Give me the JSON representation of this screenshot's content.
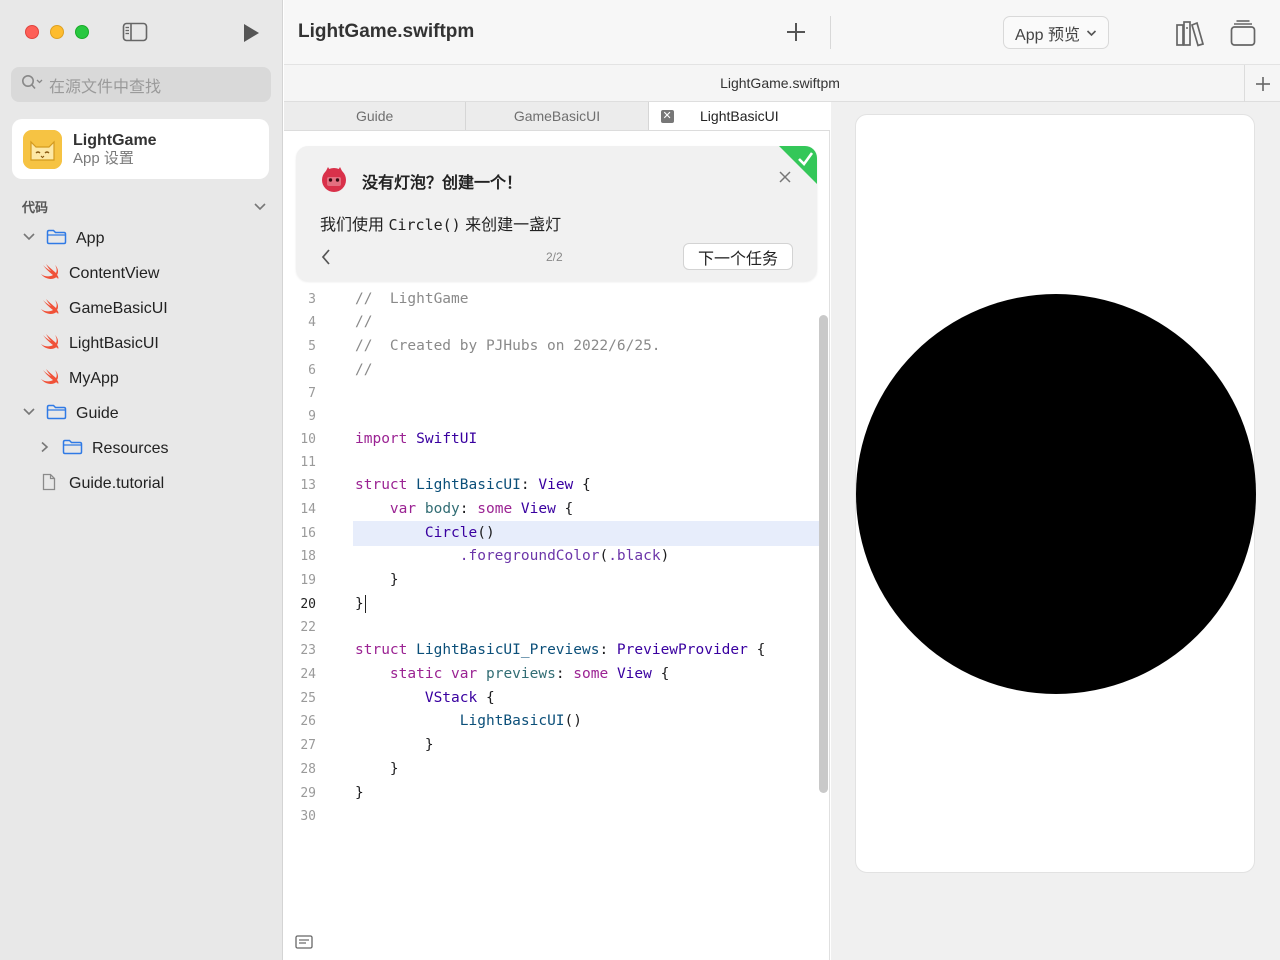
{
  "sidebar": {
    "search_placeholder": "在源文件中查找",
    "app": {
      "name": "LightGame",
      "subtitle": "App 设置"
    },
    "section_label": "代码",
    "tree": {
      "app_folder": "App",
      "content_view": "ContentView",
      "game_basic_ui": "GameBasicUI",
      "light_basic_ui": "LightBasicUI",
      "my_app": "MyApp",
      "guide_folder": "Guide",
      "resources": "Resources",
      "guide_tutorial": "Guide.tutorial"
    }
  },
  "toolbar": {
    "project_title": "LightGame.swiftpm",
    "preview_select": "App 预览"
  },
  "subbar": {
    "title": "LightGame.swiftpm"
  },
  "tabs": [
    "Guide",
    "GameBasicUI",
    "LightBasicUI"
  ],
  "guide_card": {
    "title": "没有灯泡？创建一个！",
    "body_prefix": "我们使用 ",
    "body_code": "Circle()",
    "body_suffix": " 来创建一盏灯",
    "page": "2/2",
    "next_button": "下一个任务"
  },
  "code": {
    "current_line": "20",
    "lines": [
      {
        "n": "3",
        "t": "//  LightGame"
      },
      {
        "n": "4",
        "t": "//"
      },
      {
        "n": "5",
        "t": "//  Created by PJHubs on 2022/6/25."
      },
      {
        "n": "6",
        "t": "//"
      },
      {
        "n": "7",
        "t": ""
      },
      {
        "n": "9",
        "t": ""
      },
      {
        "n": "10",
        "t": "import SwiftUI"
      },
      {
        "n": "11",
        "t": ""
      },
      {
        "n": "13",
        "t": "struct LightBasicUI: View {"
      },
      {
        "n": "14",
        "t": "    var body: some View {"
      },
      {
        "n": "16",
        "t": "        Circle()"
      },
      {
        "n": "18",
        "t": "            .foregroundColor(.black)"
      },
      {
        "n": "19",
        "t": "    }"
      },
      {
        "n": "20",
        "t": "}"
      },
      {
        "n": "22",
        "t": ""
      },
      {
        "n": "23",
        "t": "struct LightBasicUI_Previews: PreviewProvider {"
      },
      {
        "n": "24",
        "t": "    static var previews: some View {"
      },
      {
        "n": "25",
        "t": "        VStack {"
      },
      {
        "n": "26",
        "t": "            LightBasicUI()"
      },
      {
        "n": "27",
        "t": "        }"
      },
      {
        "n": "28",
        "t": "    }"
      },
      {
        "n": "29",
        "t": "}"
      },
      {
        "n": "30",
        "t": ""
      }
    ]
  },
  "preview": {
    "shape": "circle",
    "fill": "#000000"
  },
  "colors": {
    "accent_blue": "#2f7ae5",
    "swift_orange": "#f05138",
    "keyword": "#9b2393",
    "type": "#3900a0",
    "check_green": "#34c759"
  }
}
